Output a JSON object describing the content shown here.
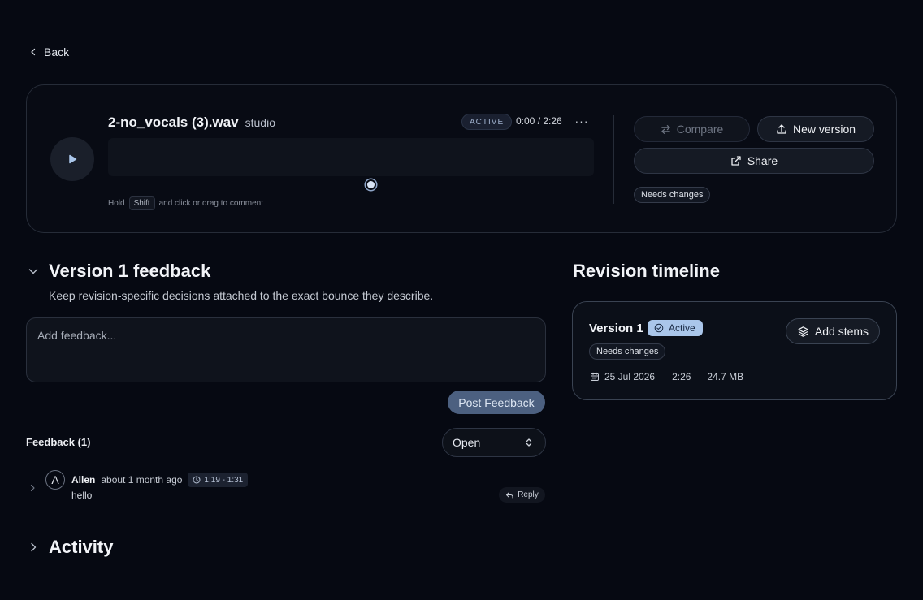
{
  "nav": {
    "back_label": "Back"
  },
  "player": {
    "file_name": "2-no_vocals (3).wav",
    "project_tag": "studio",
    "status": "ACTIVE",
    "timecode": "0:00 / 2:26",
    "more_label": "···",
    "hint_prefix": "Hold",
    "hint_key": "Shift",
    "hint_suffix": "and click or drag to comment",
    "compare_label": "Compare",
    "new_version_label": "New version",
    "share_label": "Share",
    "review_tag": "Needs changes"
  },
  "feedback": {
    "title": "Version 1 feedback",
    "subtitle": "Keep revision-specific decisions attached to the exact bounce they describe.",
    "input_placeholder": "Add feedback...",
    "post_label": "Post Feedback",
    "count_label": "Feedback (1)",
    "filter_value": "Open",
    "comments": [
      {
        "avatar_initial": "A",
        "author": "Allen",
        "time": "about 1 month ago",
        "range": "1:19 - 1:31",
        "text": "hello",
        "reply_label": "Reply"
      }
    ]
  },
  "activity": {
    "title": "Activity"
  },
  "timeline": {
    "title": "Revision timeline",
    "version": {
      "name": "Version 1",
      "status": "Active",
      "review_tag": "Needs changes",
      "date": "25 Jul 2026",
      "duration": "2:26",
      "size": "24.7 MB",
      "add_stems_label": "Add stems"
    }
  },
  "colors": {
    "background": "#060912",
    "accent": "#aac6ea",
    "post_button": "#4c6080"
  }
}
